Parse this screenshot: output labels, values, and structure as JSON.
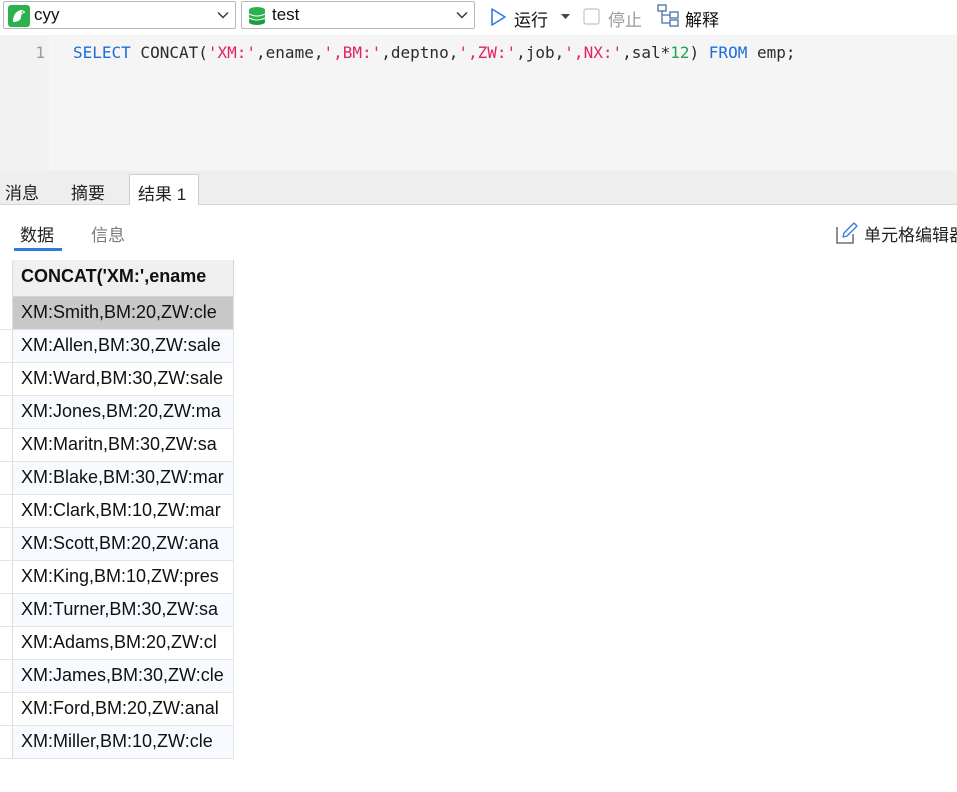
{
  "toolbar": {
    "connection": {
      "value": "cyy",
      "icon": "mysql-dolphin-icon"
    },
    "database": {
      "value": "test",
      "icon": "database-icon"
    },
    "run_label": "运行",
    "stop_label": "停止",
    "explain_label": "解释"
  },
  "editor": {
    "line_number": "1"
  },
  "result_tabs": [
    "消息",
    "摘要",
    "结果 1"
  ],
  "active_result_tab": "结果 1",
  "sub_tabs": {
    "data_label": "数据",
    "info_label": "信息"
  },
  "cell_editor_label": "单元格编辑器",
  "grid": {
    "column_header": "CONCAT('XM:',ename",
    "rows": [
      "XM:Smith,BM:20,ZW:cle",
      "XM:Allen,BM:30,ZW:sale",
      "XM:Ward,BM:30,ZW:sale",
      "XM:Jones,BM:20,ZW:ma",
      "XM:Maritn,BM:30,ZW:sa",
      "XM:Blake,BM:30,ZW:mar",
      "XM:Clark,BM:10,ZW:mar",
      "XM:Scott,BM:20,ZW:ana",
      "XM:King,BM:10,ZW:pres",
      "XM:Turner,BM:30,ZW:sa",
      "XM:Adams,BM:20,ZW:cl",
      "XM:James,BM:30,ZW:cle",
      "XM:Ford,BM:20,ZW:anal",
      "XM:Miller,BM:10,ZW:cle"
    ],
    "selected_row": 0
  },
  "colors": {
    "keyword": "#1a6fd8",
    "string": "#e0245e",
    "number": "#21a35a",
    "accent": "#2f7be0"
  }
}
